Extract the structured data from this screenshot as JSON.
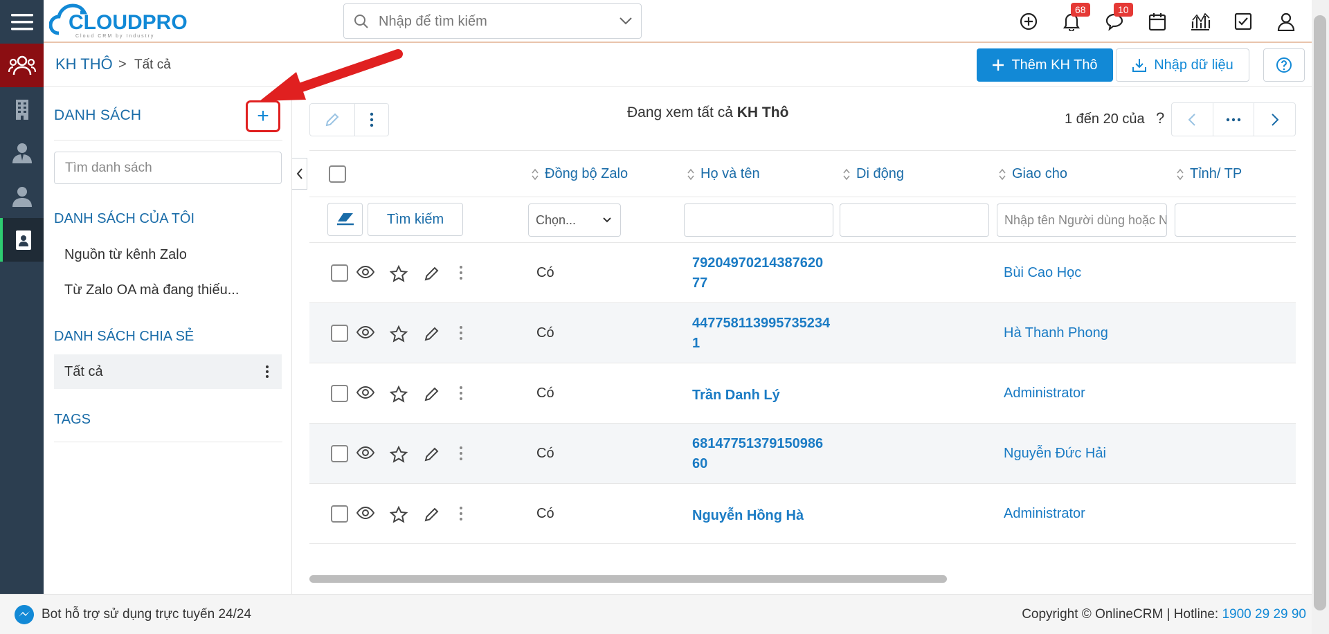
{
  "app": {
    "logo_text": "CLOUDPRO",
    "logo_tagline": "Cloud CRM by Industry"
  },
  "colors": {
    "rail": "#2c3e50",
    "rail_active": "#8b0e12",
    "primary": "#1289d6",
    "link": "#1a6ca8",
    "badge": "#e53935",
    "callout": "#e02020"
  },
  "rail": [
    {
      "icon": "menu-icon"
    },
    {
      "icon": "customers-icon",
      "active": true
    },
    {
      "icon": "building-icon"
    },
    {
      "icon": "contact-icon"
    },
    {
      "icon": "user-icon"
    },
    {
      "icon": "contact-card-icon",
      "selected": true
    }
  ],
  "search": {
    "placeholder": "Nhập để tìm kiếm"
  },
  "topbar": {
    "notifications_count": "68",
    "messages_count": "10"
  },
  "breadcrumb": {
    "module": "KH THÔ",
    "separator": ">",
    "current": "Tất cả"
  },
  "actions": {
    "add_label": "Thêm KH Thô",
    "import_label": "Nhập dữ liệu"
  },
  "lists_panel": {
    "title": "DANH SÁCH",
    "add_symbol": "+",
    "search_placeholder": "Tìm danh sách",
    "my_lists_title": "DANH SÁCH CỦA TÔI",
    "my_lists": [
      "Nguồn từ kênh Zalo",
      "Từ Zalo OA mà đang thiếu..."
    ],
    "shared_title": "DANH SÁCH CHIA SẺ",
    "shared": [
      "Tất cả"
    ],
    "tags_title": "TAGS"
  },
  "grid": {
    "viewing_prefix": "Đang xem tất cả",
    "viewing_module": "KH Thô",
    "pager_text": "1 đến 20 của",
    "pager_unknown": "?",
    "search_button": "Tìm kiếm",
    "columns": [
      "Đồng bộ Zalo",
      "Họ và tên",
      "Di động",
      "Giao cho",
      "Tỉnh/ TP"
    ],
    "filters": {
      "zalo_select": "Chọn...",
      "assignee_placeholder": "Nhập tên Người dùng hoặc Nhóm"
    },
    "rows": [
      {
        "zalo": "Có",
        "name": "7920497021438762077",
        "mobile": "",
        "assignee": "Bùi Cao Học",
        "city": ""
      },
      {
        "zalo": "Có",
        "name": "4477581139957352341",
        "mobile": "",
        "assignee": "Hà Thanh Phong",
        "city": ""
      },
      {
        "zalo": "Có",
        "name": "Trần Danh Lý",
        "mobile": "",
        "assignee": "Administrator",
        "city": ""
      },
      {
        "zalo": "Có",
        "name": "6814775137915098660",
        "mobile": "",
        "assignee": "Nguyễn Đức Hải",
        "city": ""
      },
      {
        "zalo": "Có",
        "name": "Nguyễn Hồng Hà",
        "mobile": "",
        "assignee": "Administrator",
        "city": ""
      }
    ]
  },
  "footer": {
    "bot_text": "Bot hỗ trợ sử dụng trực tuyến 24/24",
    "copyright": "Copyright © OnlineCRM",
    "separator": "|",
    "hotline_label": "Hotline:",
    "hotline_number": "1900 29 29 90"
  }
}
